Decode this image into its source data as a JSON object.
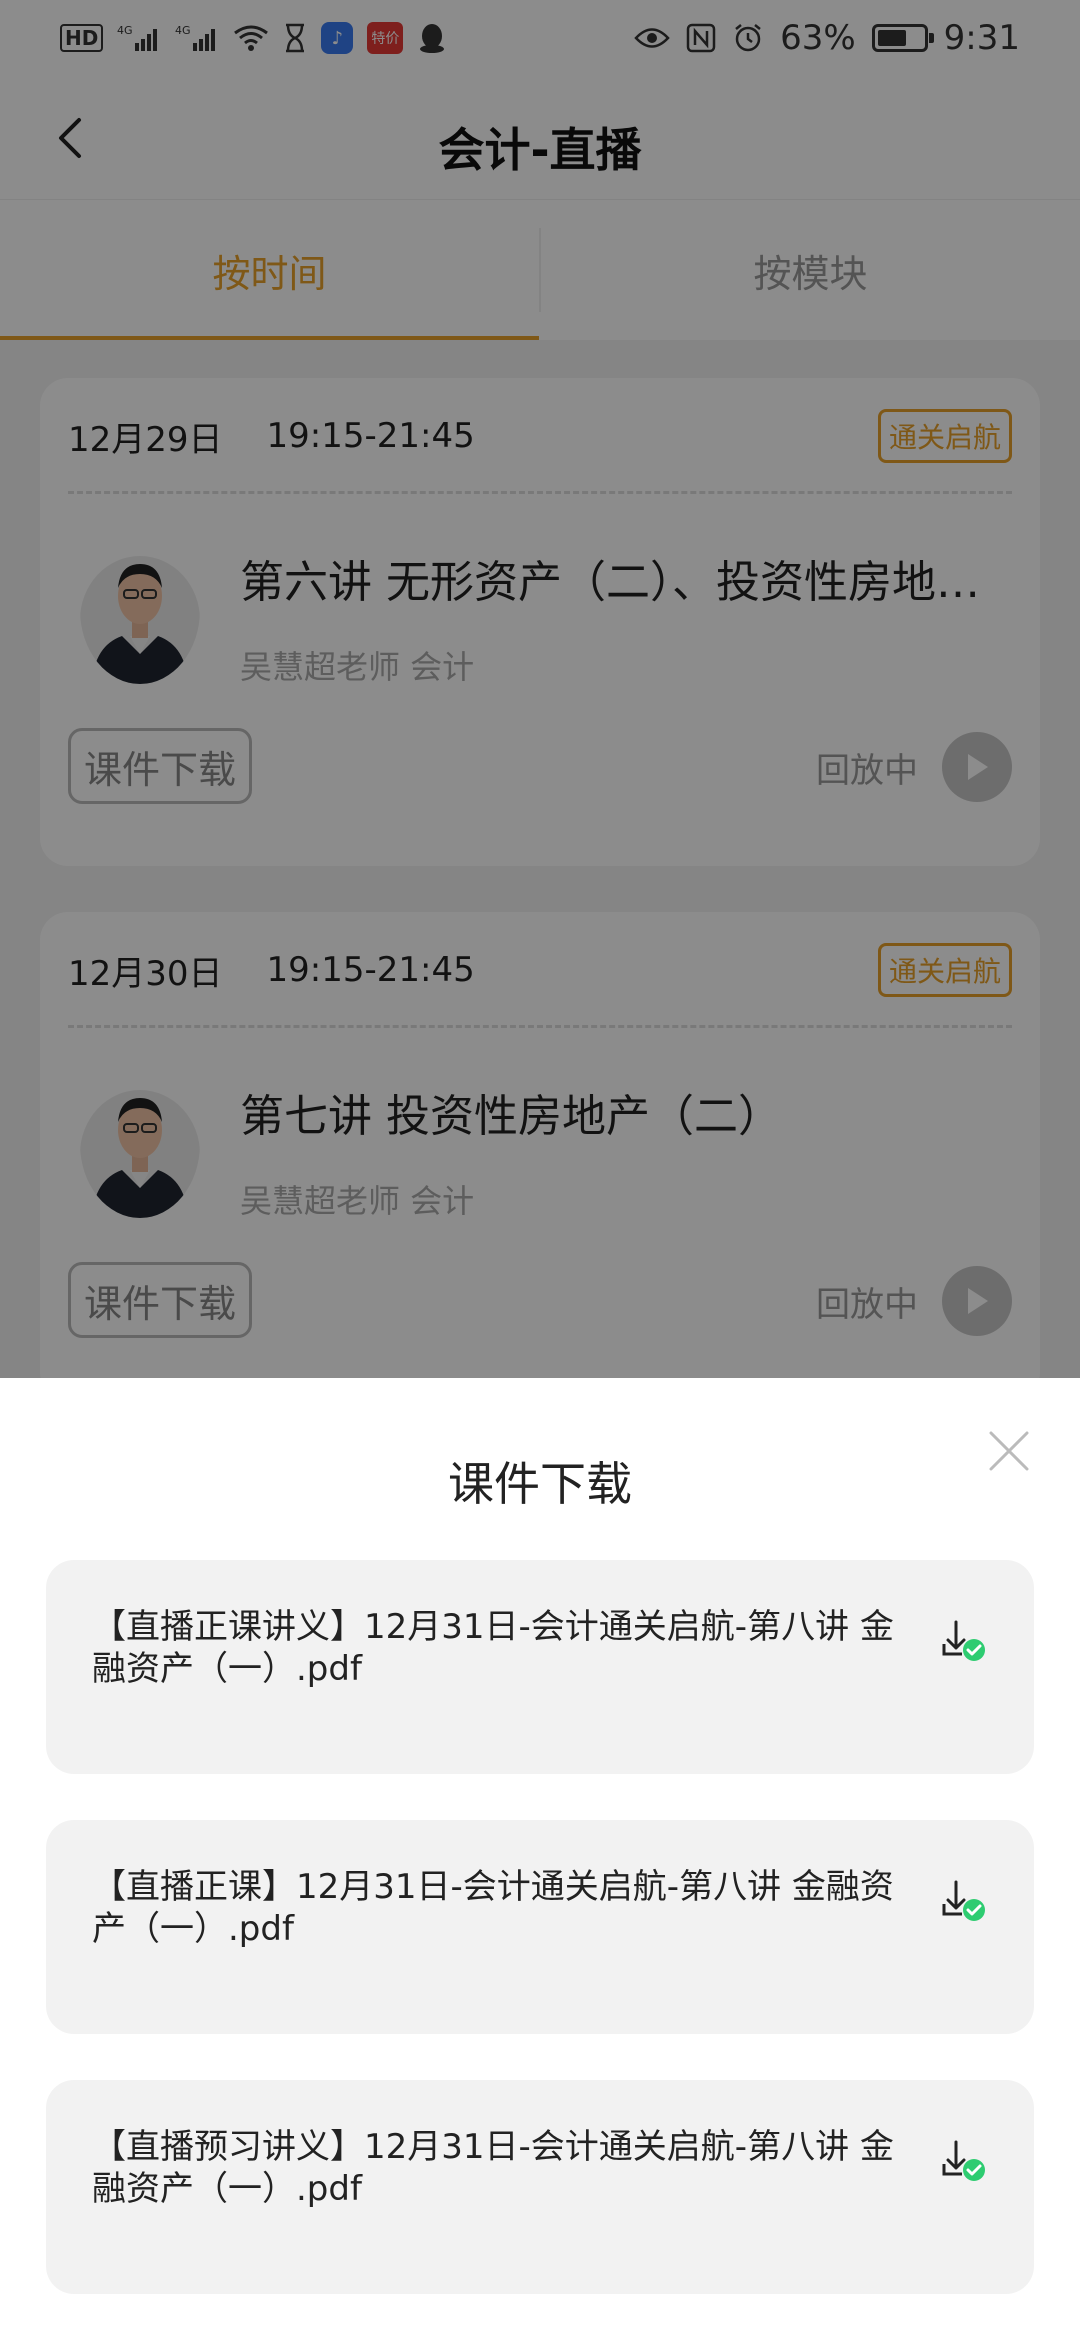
{
  "status": {
    "network_left": "4G",
    "network_right": "4G",
    "app_badge_red": "特价",
    "battery_percent": "63%",
    "battery_level": 0.63,
    "time": "9:31"
  },
  "header": {
    "title": "会计-直播"
  },
  "tabs": [
    {
      "label": "按时间",
      "active": true
    },
    {
      "label": "按模块",
      "active": false
    }
  ],
  "cards": [
    {
      "date": "12月29日",
      "time": "19:15-21:45",
      "badge": "通关启航",
      "title": "第六讲 无形资产（二）、投资性房地产（一）",
      "teacher": "吴慧超老师 会计",
      "download_label": "课件下载",
      "status": "回放中"
    },
    {
      "date": "12月30日",
      "time": "19:15-21:45",
      "badge": "通关启航",
      "title": "第七讲 投资性房地产（二）",
      "teacher": "吴慧超老师 会计",
      "download_label": "课件下载",
      "status": "回放中"
    }
  ],
  "sheet": {
    "title": "课件下载",
    "files": [
      {
        "name": "【直播正课讲义】12月31日-会计通关启航-第八讲 金融资产（一）.pdf",
        "downloaded": true
      },
      {
        "name": "【直播正课】12月31日-会计通关启航-第八讲 金融资产（一）.pdf",
        "downloaded": true
      },
      {
        "name": "【直播预习讲义】12月31日-会计通关启航-第八讲 金融资产（一）.pdf",
        "downloaded": true
      }
    ]
  },
  "colors": {
    "accent": "#e8a12a",
    "success": "#2ecc71",
    "overlay": "rgba(0,0,0,0.45)"
  }
}
